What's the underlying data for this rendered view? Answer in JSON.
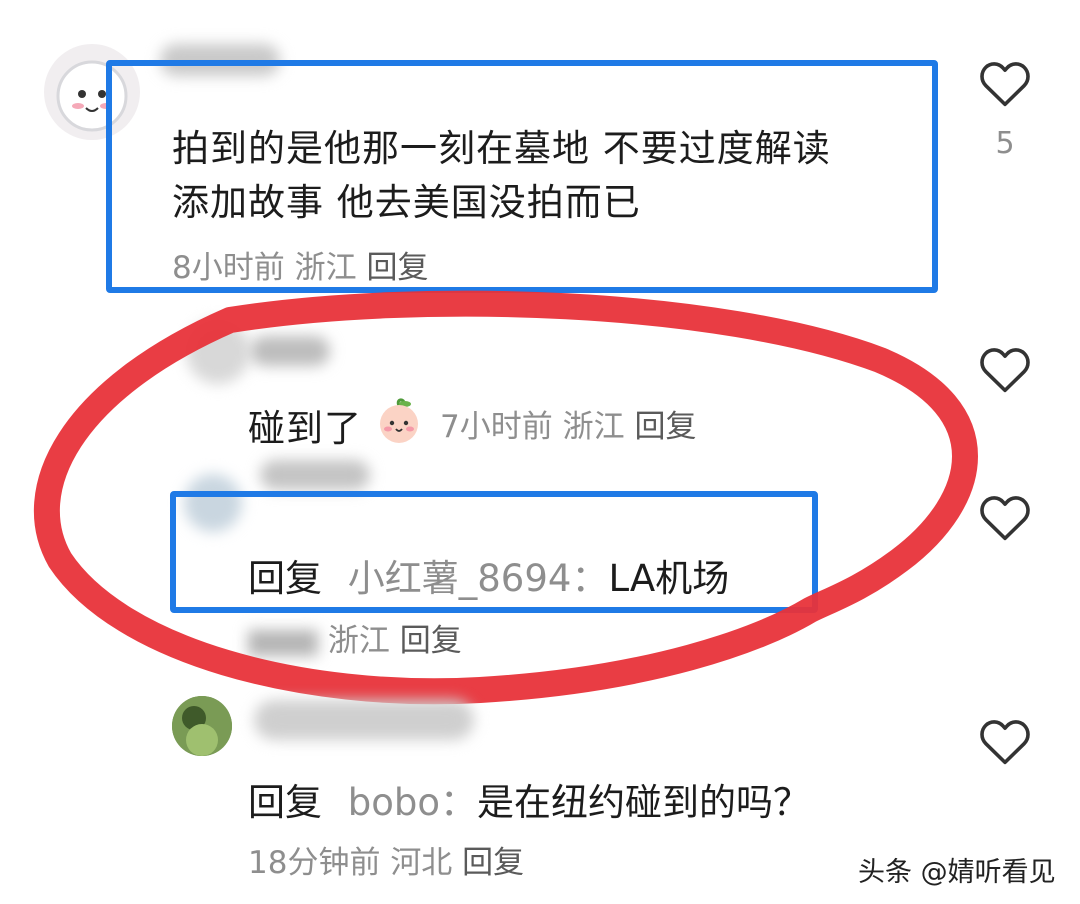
{
  "comments": [
    {
      "text_line1": "拍到的是他那一刻在墓地  不要过度解读",
      "text_line2": "添加故事 他去美国没拍而已",
      "time": "8小时前",
      "location": "浙江",
      "reply_label": "回复",
      "likes": "5"
    },
    {
      "text": "碰到了",
      "emoji": "peach-face",
      "time": "7小时前",
      "location": "浙江",
      "reply_label": "回复"
    },
    {
      "prefix": "回复",
      "mention": "小红薯_8694",
      "separator": "：",
      "text": "LA机场",
      "meta_partial": "浙江",
      "reply_label": "回复"
    },
    {
      "prefix": "回复",
      "mention": "bobo",
      "separator": "：",
      "text": "是在纽约碰到的吗？",
      "time": "18分钟前",
      "location": "河北",
      "reply_label": "回复"
    }
  ],
  "watermark": "头条 @婧听看见",
  "colors": {
    "highlight_box": "#1f7ae6",
    "circle_annotation": "#e8333a",
    "meta_text": "#8e8e8e"
  }
}
